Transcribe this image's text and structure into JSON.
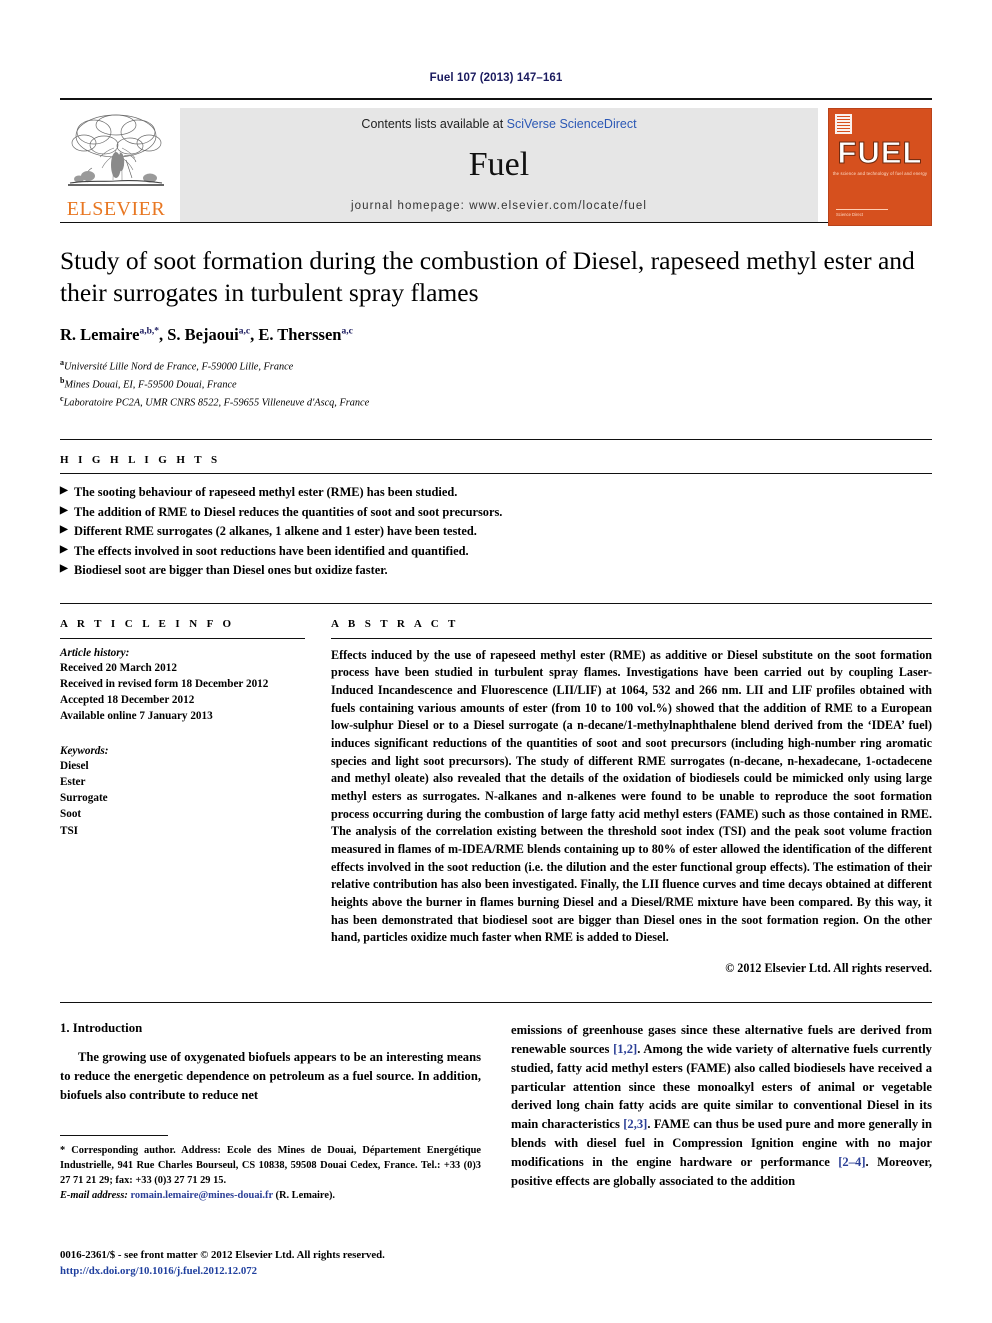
{
  "running_head": "Fuel 107 (2013) 147–161",
  "masthead": {
    "publisher_name": "ELSEVIER",
    "contents_prefix": "Contents lists available at ",
    "sciencedirect": "SciVerse ScienceDirect",
    "journal_title": "Fuel",
    "homepage": "journal homepage: www.elsevier.com/locate/fuel",
    "cover": {
      "title": "FUEL",
      "subtitle": "the science and technology of fuel and energy",
      "footer": "Science Direct"
    },
    "colors": {
      "cover_background": "#d6501e",
      "elsevier_orange": "#E87722",
      "link_blue": "#2b58b5",
      "band_gray": "#e6e6e6"
    }
  },
  "article": {
    "title": "Study of soot formation during the combustion of Diesel, rapeseed methyl ester and their surrogates in turbulent spray flames",
    "authors": [
      {
        "name": "R. Lemaire",
        "marks": "a,b,*"
      },
      {
        "name": "S. Bejaoui",
        "marks": "a,c"
      },
      {
        "name": "E. Therssen",
        "marks": "a,c"
      }
    ],
    "affiliations": [
      {
        "mark": "a",
        "text": "Université Lille Nord de France, F-59000 Lille, France"
      },
      {
        "mark": "b",
        "text": "Mines Douai, EI, F-59500 Douai, France"
      },
      {
        "mark": "c",
        "text": "Laboratoire PC2A, UMR CNRS 8522, F-59655 Villeneuve d'Ascq, France"
      }
    ]
  },
  "highlights": {
    "heading": "H I G H L I G H T S",
    "bullet_glyph": "▶",
    "items": [
      "The sooting behaviour of rapeseed methyl ester (RME) has been studied.",
      "The addition of RME to Diesel reduces the quantities of soot and soot precursors.",
      "Different RME surrogates (2 alkanes, 1 alkene and 1 ester) have been tested.",
      "The effects involved in soot reductions have been identified and quantified.",
      "Biodiesel soot are bigger than Diesel ones but oxidize faster."
    ]
  },
  "article_info": {
    "heading": "A R T I C L E  I N F O",
    "history_label": "Article history:",
    "history": [
      "Received 20 March 2012",
      "Received in revised form 18 December 2012",
      "Accepted 18 December 2012",
      "Available online 7 January 2013"
    ],
    "keywords_label": "Keywords:",
    "keywords": [
      "Diesel",
      "Ester",
      "Surrogate",
      "Soot",
      "TSI"
    ]
  },
  "abstract": {
    "heading": "A B S T R A C T",
    "text": "Effects induced by the use of rapeseed methyl ester (RME) as additive or Diesel substitute on the soot formation process have been studied in turbulent spray flames. Investigations have been carried out by coupling Laser-Induced Incandescence and Fluorescence (LII/LIF) at 1064, 532 and 266 nm. LII and LIF profiles obtained with fuels containing various amounts of ester (from 10 to 100 vol.%) showed that the addition of RME to a European low-sulphur Diesel or to a Diesel surrogate (a n-decane/1-methylnaphthalene blend derived from the ‘IDEA’ fuel) induces significant reductions of the quantities of soot and soot precursors (including high-number ring aromatic species and light soot precursors). The study of different RME surrogates (n-decane, n-hexadecane, 1-octadecene and methyl oleate) also revealed that the details of the oxidation of biodiesels could be mimicked only using large methyl esters as surrogates. N-alkanes and n-alkenes were found to be unable to reproduce the soot formation process occurring during the combustion of large fatty acid methyl esters (FAME) such as those contained in RME. The analysis of the correlation existing between the threshold soot index (TSI) and the peak soot volume fraction measured in flames of m-IDEA/RME blends containing up to 80% of ester allowed the identification of the different effects involved in the soot reduction (i.e. the dilution and the ester functional group effects). The estimation of their relative contribution has also been investigated. Finally, the LII fluence curves and time decays obtained at different heights above the burner in flames burning Diesel and a Diesel/RME mixture have been compared. By this way, it has been demonstrated that biodiesel soot are bigger than Diesel ones in the soot formation region. On the other hand, particles oxidize much faster when RME is added to Diesel.",
    "copyright": "© 2012 Elsevier Ltd. All rights reserved."
  },
  "introduction": {
    "section_number_title": "1. Introduction",
    "left_paragraph": "The growing use of oxygenated biofuels appears to be an interesting means to reduce the energetic dependence on petroleum as a fuel source. In addition, biofuels also contribute to reduce net",
    "right_paragraph_part1": "emissions of greenhouse gases since these alternative fuels are derived from renewable sources ",
    "right_cite1": "[1,2]",
    "right_paragraph_part2": ". Among the wide variety of alternative fuels currently studied, fatty acid methyl esters (FAME) also called biodiesels have received a particular attention since these monoalkyl esters of animal or vegetable derived long chain fatty acids are quite similar to conventional Diesel in its main characteristics ",
    "right_cite2": "[2,3]",
    "right_paragraph_part3": ". FAME can thus be used pure and more generally in blends with diesel fuel in Compression Ignition engine with no major modifications in the engine hardware or performance ",
    "right_cite3": "[2–4]",
    "right_paragraph_part4": ". Moreover, positive effects are globally associated to the addition"
  },
  "footnote": {
    "corresponding": "* Corresponding author. Address: Ecole des Mines de Douai, Département Energétique Industrielle, 941 Rue Charles Bourseul, CS 10838, 59508 Douai Cedex, France. Tel.: +33 (0)3 27 71 21 29; fax: +33 (0)3 27 71 29 15.",
    "email_label": "E-mail address:",
    "email": "romain.lemaire@mines-douai.fr",
    "email_suffix": " (R. Lemaire)."
  },
  "imprint": {
    "line1": "0016-2361/$ - see front matter © 2012 Elsevier Ltd. All rights reserved.",
    "doi": "http://dx.doi.org/10.1016/j.fuel.2012.12.072"
  }
}
